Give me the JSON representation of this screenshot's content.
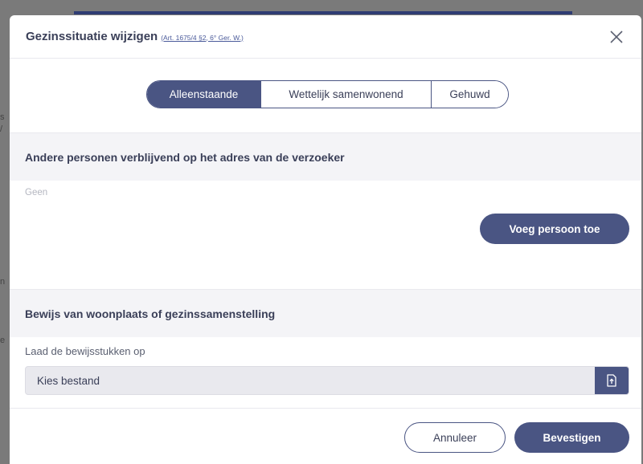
{
  "modal": {
    "title": "Gezinssituatie wijzigen",
    "legal_ref": "(Art. 1675/4 §2, 6° Ger. W.)",
    "close_icon": "close-icon"
  },
  "marital_status": {
    "options": [
      "Alleenstaande",
      "Wettelijk samenwonend",
      "Gehuwd"
    ],
    "selected": "Alleenstaande"
  },
  "other_persons": {
    "heading": "Andere personen verblijvend op het adres van de verzoeker",
    "empty_text": "Geen",
    "add_button": "Voeg persoon toe"
  },
  "proof": {
    "heading": "Bewijs van woonplaats of gezinssamenstelling",
    "upload_label": "Laad de bewijsstukken op",
    "file_placeholder": "Kies bestand",
    "upload_icon": "file-upload-icon"
  },
  "footer": {
    "cancel_label": "Annuleer",
    "confirm_label": "Bevestigen"
  },
  "colors": {
    "accent": "#4a5583",
    "section_bg": "#f4f4f7",
    "overlay": "#7a7a7a"
  }
}
